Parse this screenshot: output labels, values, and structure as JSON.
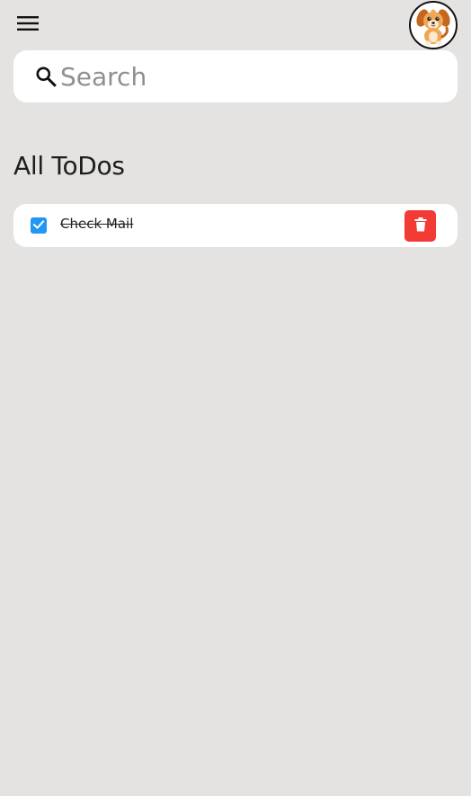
{
  "app_bar": {
    "menu_icon": "menu-icon",
    "avatar_icon": "puppy-avatar"
  },
  "search": {
    "placeholder": "Search",
    "value": "",
    "icon": "search-icon"
  },
  "section": {
    "title": "All ToDos"
  },
  "todos": [
    {
      "label": "Check Mail",
      "done": true,
      "delete_icon": "trash-icon"
    }
  ],
  "colors": {
    "background": "#e4e3e1",
    "card": "#ffffff",
    "checkbox": "#2196f3",
    "delete": "#f23b35"
  }
}
